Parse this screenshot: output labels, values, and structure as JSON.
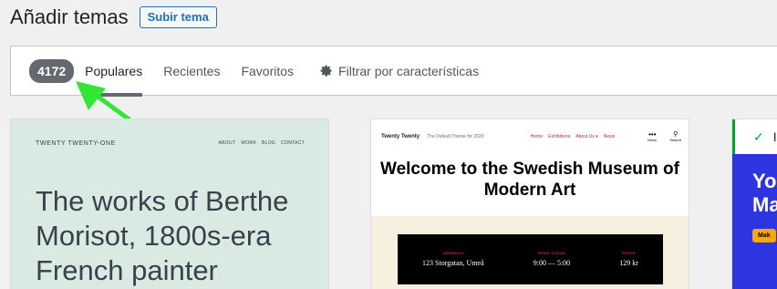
{
  "header": {
    "title": "Añadir temas",
    "upload_label": "Subir tema"
  },
  "filter": {
    "count": "4172",
    "tabs": [
      {
        "label": "Populares",
        "active": true
      },
      {
        "label": "Recientes",
        "active": false
      },
      {
        "label": "Favoritos",
        "active": false
      }
    ],
    "features_label": "Filtrar por características",
    "features_icon": "gear-icon"
  },
  "annotation": {
    "arrow_color": "#33e634"
  },
  "themes": [
    {
      "site_title": "TWENTY TWENTY-ONE",
      "nav": [
        "ABOUT",
        "WORK",
        "BLOG",
        "CONTACT"
      ],
      "headline": "The works of Berthe Morisot, 1800s-era French painter"
    },
    {
      "brand": "Twenty Twenty",
      "tagline": "The Default Theme for 2020",
      "nav": [
        "Home",
        "Exhibitions",
        "About Us ▾",
        "News"
      ],
      "menu_label": "Menu",
      "search_label": "Search",
      "heading": "Welcome to the Swedish Museum of Modern Art",
      "info": [
        {
          "label": "ADDRESS",
          "value": "123 Storgatan, Umeå"
        },
        {
          "label": "OPEN TODAY",
          "value": "9:00 — 5:00"
        },
        {
          "label": "PRICE",
          "value": "129 kr"
        }
      ]
    },
    {
      "installed_text": "In",
      "big_text": "Yo Ma",
      "button_label": "Mak"
    }
  ],
  "colors": {
    "accent": "#2271b1",
    "badge_bg": "#646970",
    "card1_bg": "#d8eae1",
    "card3_bg": "#2e35e0",
    "twentytwenty_red": "#cd2653"
  }
}
